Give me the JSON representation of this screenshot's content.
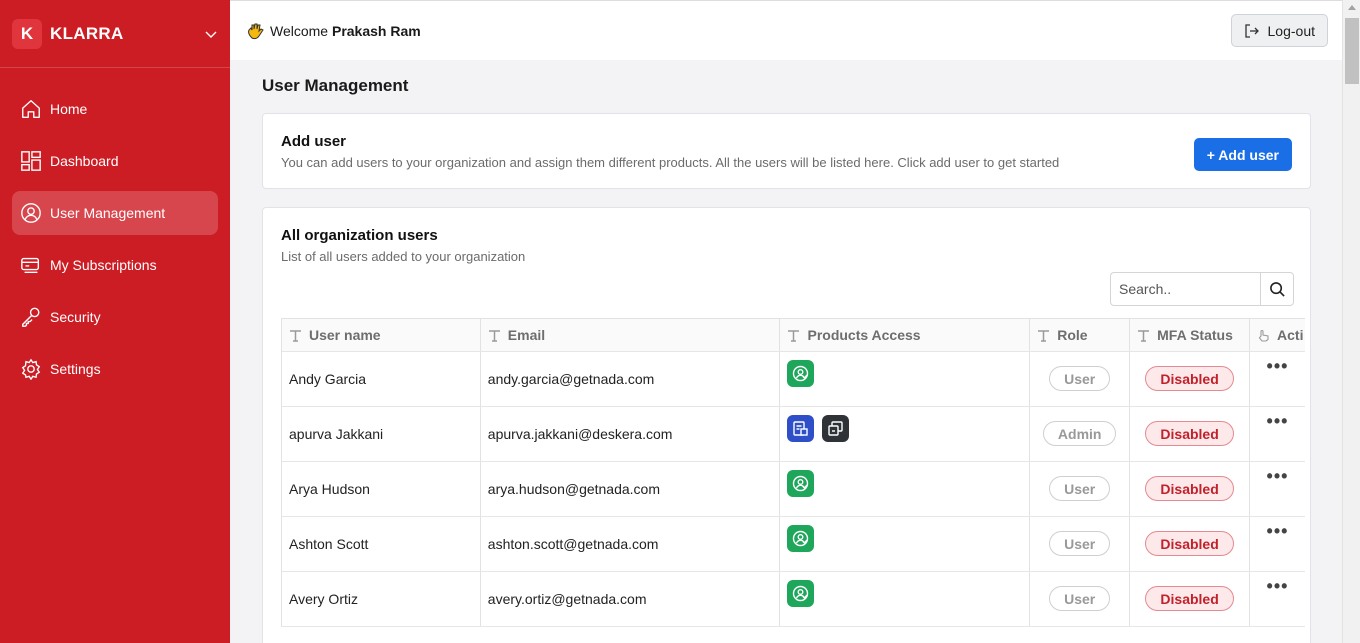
{
  "brand": {
    "letter": "K",
    "name": "KLARRA"
  },
  "sidebar": {
    "items": [
      {
        "label": "Home",
        "icon": "home-icon"
      },
      {
        "label": "Dashboard",
        "icon": "dashboard-icon"
      },
      {
        "label": "User Management",
        "icon": "user-circle-icon",
        "active": true
      },
      {
        "label": "My Subscriptions",
        "icon": "subscriptions-icon"
      },
      {
        "label": "Security",
        "icon": "key-icon"
      },
      {
        "label": "Settings",
        "icon": "gear-icon"
      }
    ]
  },
  "header": {
    "welcome": "Welcome",
    "user": "Prakash Ram",
    "logout_label": "Log-out"
  },
  "main": {
    "title": "User Management",
    "add_card": {
      "title": "Add user",
      "subtitle": "You can add users to your organization and assign them different products. All the users will be listed here. Click add user to get started",
      "button": "+ Add user"
    },
    "users_card": {
      "title": "All organization users",
      "subtitle": "List of all users added to your organization",
      "search_placeholder": "Search.."
    }
  },
  "table": {
    "columns": [
      "User name",
      "Email",
      "Products Access",
      "Role",
      "MFA Status",
      "Acti"
    ],
    "rows": [
      {
        "name": "Andy Garcia",
        "email": "andy.garcia@getnada.com",
        "products": [
          "green"
        ],
        "role": "User",
        "mfa": "Disabled"
      },
      {
        "name": "apurva Jakkani",
        "email": "apurva.jakkani@deskera.com",
        "products": [
          "blue",
          "dark"
        ],
        "role": "Admin",
        "mfa": "Disabled"
      },
      {
        "name": "Arya Hudson",
        "email": "arya.hudson@getnada.com",
        "products": [
          "green"
        ],
        "role": "User",
        "mfa": "Disabled"
      },
      {
        "name": "Ashton Scott",
        "email": "ashton.scott@getnada.com",
        "products": [
          "green"
        ],
        "role": "User",
        "mfa": "Disabled"
      },
      {
        "name": "Avery Ortiz",
        "email": "avery.ortiz@getnada.com",
        "products": [
          "green"
        ],
        "role": "User",
        "mfa": "Disabled"
      }
    ],
    "actions_glyph": "•••"
  },
  "colors": {
    "sidebar": "#cc1c24",
    "accent": "#1a6fe6",
    "product_green": "#1ea65a",
    "product_blue": "#2e4fc7",
    "product_dark": "#2f3338"
  }
}
